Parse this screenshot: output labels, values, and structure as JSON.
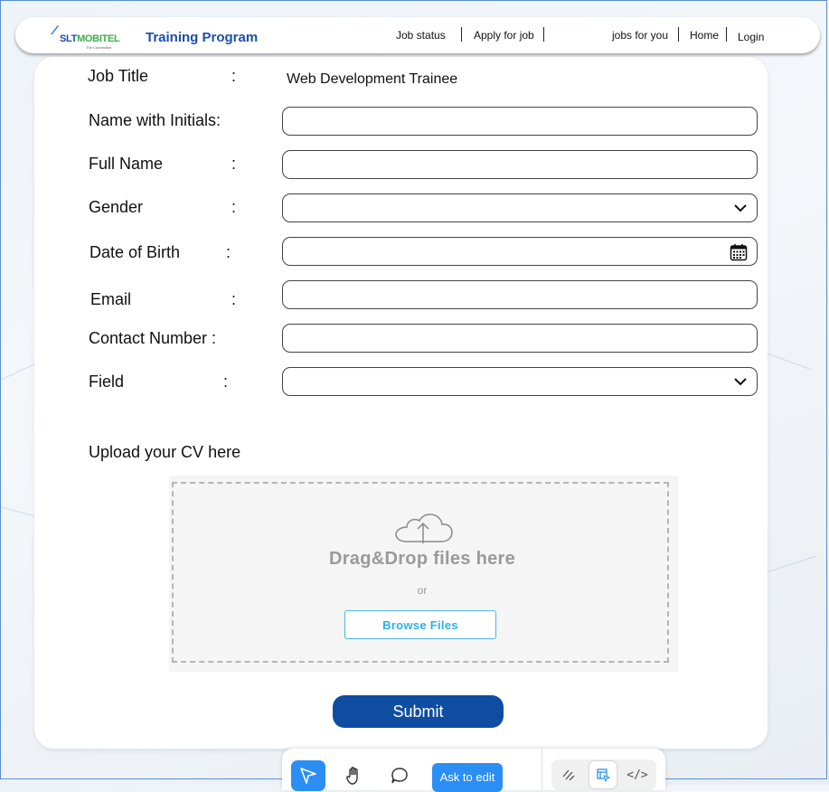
{
  "header": {
    "logo_mark": "∕∕",
    "logo_slt": "SLT",
    "logo_mobitel": "MOBITEL",
    "logo_tagline": "The Connection",
    "title": "Training Program",
    "nav": {
      "job_status": "Job status",
      "apply": "Apply for job",
      "jobs_for_you": "jobs for you",
      "home": "Home",
      "login": "Login"
    }
  },
  "form": {
    "colon": ":",
    "job_title_label": "Job Title",
    "job_title_value": "Web Development Trainee",
    "name_initials_label": "Name with Initials:",
    "full_name_label": "Full Name",
    "gender_label": "Gender",
    "dob_label": "Date of Birth",
    "email_label": "Email",
    "contact_label": "Contact Number :",
    "field_label": "Field"
  },
  "upload": {
    "title": "Upload your CV here",
    "drag_text": "Drag&Drop files here",
    "or_text": "or",
    "browse_label": "Browse Files"
  },
  "submit_label": "Submit",
  "toolbar": {
    "ask_label": "Ask to edit",
    "icons": [
      "pointer-icon",
      "hand-icon",
      "comment-icon",
      "draw-icon",
      "layout-select-icon",
      "code-icon"
    ],
    "code_glyph": "</>"
  },
  "colors": {
    "brand_blue": "#1b4fa8",
    "brand_green": "#3cae4a",
    "submit_blue": "#0e4da0",
    "browse_cyan": "#2cb0e8",
    "toolbar_accent": "#2a8ef5"
  }
}
